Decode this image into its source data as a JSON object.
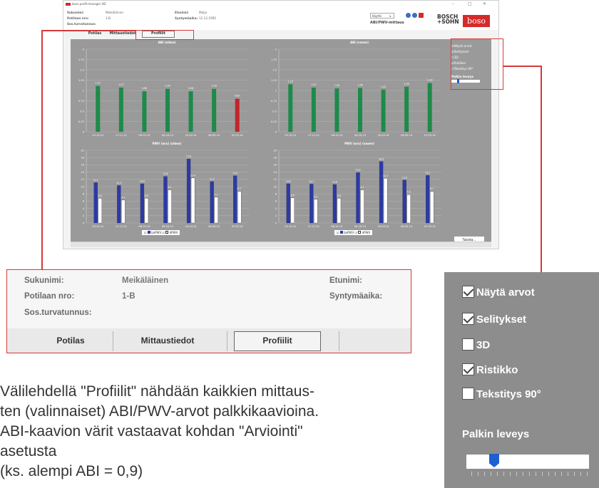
{
  "window": {
    "title": "boso profil-manager XD",
    "controls": [
      "–",
      "□",
      "✕"
    ]
  },
  "header": {
    "surname_label": "Sukunimi:",
    "surname_value": "Meikäläinen",
    "patient_no_label": "Potilaan nro:",
    "patient_no_value": "1-B",
    "ssn_label": "Sos.turvatunnus:",
    "firstname_label": "Etunimi:",
    "firstname_value": "Maija",
    "birthdate_label": "Syntymäaika:",
    "birthdate_value": "12.12.1950",
    "usage_select": "Käyttö",
    "mode_label": "ABI/PWV-mittaus",
    "brand_bosch": "BOSCH\n+SOHN",
    "brand_boso": "boso",
    "colors": {
      "brand_red": "#d42a2a",
      "info_blue": "#3a6fc4"
    }
  },
  "tabs": [
    {
      "label": "Potilas",
      "active": false
    },
    {
      "label": "Mittaustiedot",
      "active": false
    },
    {
      "label": "Profiilit",
      "active": true
    }
  ],
  "chart_data": [
    {
      "type": "bar",
      "title": "ABI (oikea)",
      "categories": [
        "23.10.12",
        "17.11.12",
        "08.10.13",
        "06.10.13",
        "20.04.14",
        "06.05.14",
        "07.05.14"
      ],
      "series": [
        {
          "values": [
            1.11,
            1.07,
            0.98,
            1.04,
            0.98,
            1.04,
            0.8
          ]
        }
      ],
      "ylim": [
        0,
        2
      ],
      "yticks": [
        "0",
        "0.25",
        "0.5",
        "0.75",
        "1",
        "1.25",
        "1.5",
        "1.75",
        "2"
      ],
      "colors": [
        "#1e8a4a",
        "#1e8a4a",
        "#1e8a4a",
        "#1e8a4a",
        "#1e8a4a",
        "#1e8a4a",
        "#c0262b"
      ],
      "grid": true
    },
    {
      "type": "bar",
      "title": "ABI (vasen)",
      "categories": [
        "23.10.12",
        "17.11.12",
        "08.10.13",
        "06.10.13",
        "20.04.14",
        "06.05.14",
        "07.05.14"
      ],
      "series": [
        {
          "values": [
            1.15,
            1.07,
            1.05,
            1.06,
            1.02,
            1.09,
            1.18
          ]
        }
      ],
      "ylim": [
        0,
        2
      ],
      "yticks": [
        "0",
        "0.25",
        "0.5",
        "0.75",
        "1",
        "1.25",
        "1.5",
        "1.75",
        "2"
      ],
      "colors": [
        "#1e8a4a",
        "#1e8a4a",
        "#1e8a4a",
        "#1e8a4a",
        "#1e8a4a",
        "#1e8a4a",
        "#1e8a4a"
      ],
      "grid": true
    },
    {
      "type": "bar",
      "title": "PWV (m/s) (oikea)",
      "categories": [
        "23.10.12",
        "17.11.12",
        "08.10.13",
        "06.10.13",
        "20.04.14",
        "06.05.14",
        "07.05.14"
      ],
      "series": [
        {
          "name": "baPWV",
          "values": [
            11.1,
            10.3,
            10.8,
            12.8,
            17.6,
            11.4,
            13.0
          ]
        },
        {
          "name": "dPWV",
          "values": [
            6.8,
            6.3,
            6.8,
            9.1,
            12.4,
            7.1,
            8.7
          ]
        }
      ],
      "ylim": [
        0,
        20
      ],
      "yticks": [
        "0",
        "2",
        "4",
        "6",
        "8",
        "10",
        "12",
        "14",
        "16",
        "18",
        "20"
      ],
      "grid": true,
      "legend": "bottom"
    },
    {
      "type": "bar",
      "title": "PWV (m/s) (vasen)",
      "categories": [
        "23.10.12",
        "17.11.12",
        "08.10.13",
        "06.10.13",
        "20.04.14",
        "06.05.14",
        "07.05.14"
      ],
      "series": [
        {
          "name": "baPWV",
          "values": [
            10.8,
            10.7,
            10.6,
            13.9,
            16.9,
            11.8,
            13.1
          ]
        },
        {
          "name": "dPWV",
          "values": [
            6.9,
            6.5,
            6.8,
            9.1,
            12.3,
            7.8,
            8.7
          ]
        }
      ],
      "ylim": [
        0,
        20
      ],
      "yticks": [
        "0",
        "2",
        "4",
        "6",
        "8",
        "10",
        "12",
        "14",
        "16",
        "18",
        "20"
      ],
      "grid": true,
      "legend": "bottom"
    }
  ],
  "legend_labels": {
    "ba": "baPWV",
    "d": "dPWV"
  },
  "options": {
    "show_values": {
      "label": "Näytä arvot",
      "checked": true
    },
    "legends": {
      "label": "Selitykset",
      "checked": true
    },
    "three_d": {
      "label": "3D",
      "checked": false
    },
    "grid": {
      "label": "Ristikko",
      "checked": true
    },
    "label90": {
      "label": "Tekstitys 90°",
      "checked": false
    },
    "bar_width_label": "Palkin leveys",
    "bar_width_level": 0.2
  },
  "print_button": "Tulosta...",
  "caption_lines": [
    "Välilehdellä \"Profiilit\" nähdään kaikkien mittaus-",
    "ten (valinnaiset) ABI/PWV-arvot palkkikaavioina.",
    "ABI-kaavion värit vastaavat kohdan \"Arviointi\"",
    "asetusta",
    "(ks. alempi ABI = 0,9)"
  ]
}
